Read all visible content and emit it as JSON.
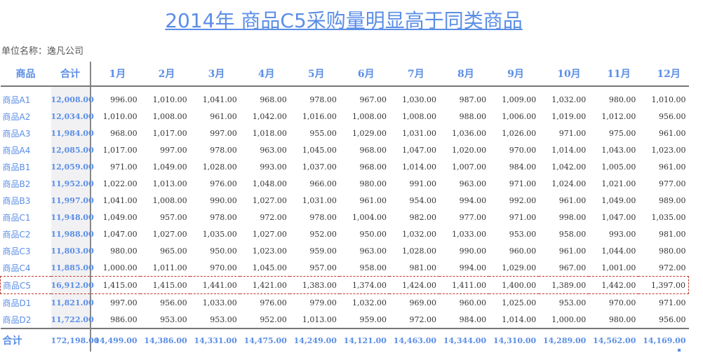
{
  "title": "2014年 商品C5采购量明显高于同类商品",
  "unit": "单位名称：逸凡公司",
  "headers": {
    "name": "商品",
    "total": "合计",
    "months": [
      "1月",
      "2月",
      "3月",
      "4月",
      "5月",
      "6月",
      "7月",
      "8月",
      "9月",
      "10月",
      "11月",
      "12月"
    ]
  },
  "highlight_row": "商品C5",
  "rows": [
    {
      "name": "商品A1",
      "total": "12,008.00",
      "values": [
        "996.00",
        "1,010.00",
        "1,041.00",
        "968.00",
        "978.00",
        "967.00",
        "1,030.00",
        "987.00",
        "1,009.00",
        "1,032.00",
        "980.00",
        "1,010.00"
      ]
    },
    {
      "name": "商品A2",
      "total": "12,034.00",
      "values": [
        "1,010.00",
        "1,008.00",
        "961.00",
        "1,042.00",
        "1,016.00",
        "1,008.00",
        "1,008.00",
        "988.00",
        "1,006.00",
        "1,019.00",
        "1,012.00",
        "956.00"
      ]
    },
    {
      "name": "商品A3",
      "total": "11,984.00",
      "values": [
        "968.00",
        "1,017.00",
        "997.00",
        "1,018.00",
        "955.00",
        "1,029.00",
        "1,031.00",
        "1,036.00",
        "1,026.00",
        "971.00",
        "975.00",
        "961.00"
      ]
    },
    {
      "name": "商品A4",
      "total": "12,085.00",
      "values": [
        "1,017.00",
        "997.00",
        "978.00",
        "963.00",
        "1,045.00",
        "968.00",
        "1,047.00",
        "1,020.00",
        "970.00",
        "1,014.00",
        "1,043.00",
        "1,023.00"
      ]
    },
    {
      "name": "商品B1",
      "total": "12,059.00",
      "values": [
        "971.00",
        "1,049.00",
        "1,028.00",
        "993.00",
        "1,037.00",
        "968.00",
        "1,014.00",
        "1,007.00",
        "984.00",
        "1,042.00",
        "1,005.00",
        "961.00"
      ]
    },
    {
      "name": "商品B2",
      "total": "11,952.00",
      "values": [
        "1,022.00",
        "1,013.00",
        "976.00",
        "1,048.00",
        "966.00",
        "980.00",
        "991.00",
        "963.00",
        "971.00",
        "1,024.00",
        "1,021.00",
        "977.00"
      ]
    },
    {
      "name": "商品B3",
      "total": "11,997.00",
      "values": [
        "1,041.00",
        "1,008.00",
        "990.00",
        "1,027.00",
        "1,031.00",
        "961.00",
        "954.00",
        "994.00",
        "992.00",
        "961.00",
        "1,049.00",
        "989.00"
      ]
    },
    {
      "name": "商品C1",
      "total": "11,948.00",
      "values": [
        "1,049.00",
        "957.00",
        "978.00",
        "972.00",
        "978.00",
        "1,004.00",
        "982.00",
        "977.00",
        "971.00",
        "998.00",
        "1,047.00",
        "1,035.00"
      ]
    },
    {
      "name": "商品C2",
      "total": "11,988.00",
      "values": [
        "1,047.00",
        "1,027.00",
        "1,035.00",
        "1,027.00",
        "952.00",
        "950.00",
        "1,032.00",
        "1,033.00",
        "953.00",
        "958.00",
        "993.00",
        "981.00"
      ]
    },
    {
      "name": "商品C3",
      "total": "11,803.00",
      "values": [
        "980.00",
        "965.00",
        "950.00",
        "1,023.00",
        "959.00",
        "963.00",
        "1,028.00",
        "990.00",
        "960.00",
        "961.00",
        "1,044.00",
        "980.00"
      ]
    },
    {
      "name": "商品C4",
      "total": "11,885.00",
      "values": [
        "1,000.00",
        "1,011.00",
        "970.00",
        "1,045.00",
        "957.00",
        "958.00",
        "981.00",
        "994.00",
        "1,029.00",
        "967.00",
        "1,001.00",
        "972.00"
      ]
    },
    {
      "name": "商品C5",
      "total": "16,912.00",
      "values": [
        "1,415.00",
        "1,415.00",
        "1,441.00",
        "1,421.00",
        "1,383.00",
        "1,374.00",
        "1,424.00",
        "1,411.00",
        "1,400.00",
        "1,389.00",
        "1,442.00",
        "1,397.00"
      ]
    },
    {
      "name": "商品D1",
      "total": "11,821.00",
      "values": [
        "997.00",
        "956.00",
        "1,033.00",
        "976.00",
        "979.00",
        "1,032.00",
        "969.00",
        "960.00",
        "1,025.00",
        "953.00",
        "970.00",
        "971.00"
      ]
    },
    {
      "name": "商品D2",
      "total": "11,722.00",
      "values": [
        "986.00",
        "953.00",
        "953.00",
        "952.00",
        "1,013.00",
        "959.00",
        "972.00",
        "984.00",
        "1,014.00",
        "1,000.00",
        "980.00",
        "956.00"
      ]
    }
  ],
  "summary": {
    "name": "合计",
    "total": "172,198.00",
    "values": [
      "14,499.00",
      "14,386.00",
      "14,331.00",
      "14,475.00",
      "14,249.00",
      "14,121.00",
      "14,463.00",
      "14,344.00",
      "14,310.00",
      "14,289.00",
      "14,562.00",
      "14,169.00"
    ]
  },
  "colors": {
    "accent": "#5b8ee6",
    "highlight_border": "#c0392b",
    "total_column_bg": "#f1f1f3"
  }
}
